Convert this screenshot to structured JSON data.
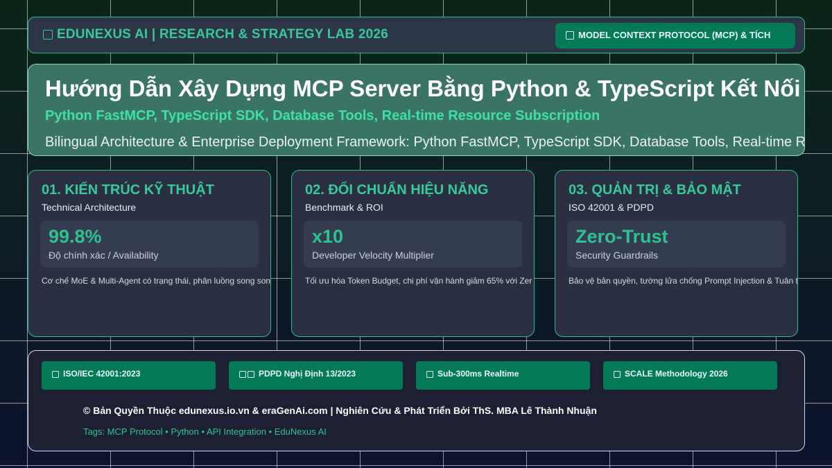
{
  "header": {
    "brand": "EDUNEXUS AI | RESEARCH & STRATEGY LAB 2026",
    "brand_icon": "box-icon",
    "badge": "MODEL CONTEXT PROTOCOL (MCP) & TÍCH",
    "badge_icon": "box-icon"
  },
  "hero": {
    "title": "Hướng Dẫn Xây Dựng MCP Server Bằng Python & TypeScript Kết Nối",
    "subtitle": "Python FastMCP, TypeScript SDK, Database Tools, Real-time Resource Subscription",
    "description": "Bilingual Architecture & Enterprise Deployment Framework: Python FastMCP, TypeScript SDK, Database Tools, Real-time Reso"
  },
  "cards": [
    {
      "title": "01. KIẾN TRÚC KỸ THUẬT",
      "subtitle": "Technical Architecture",
      "metric_value": "99.8%",
      "metric_label": "Độ chính xác / Availability",
      "text": "Cơ chế MoE & Multi-Agent có trạng thái, phân luồng song son"
    },
    {
      "title": "02. ĐỐI CHUẨN HIỆU NĂNG",
      "subtitle": "Benchmark & ROI",
      "metric_value": "x10",
      "metric_label": "Developer Velocity Multiplier",
      "text": "Tối ưu hóa Token Budget, chi phí vận hành giảm 65% với Zer"
    },
    {
      "title": "03. QUẢN TRỊ & BẢO MẬT",
      "subtitle": "ISO 42001 & PDPD",
      "metric_value": "Zero-Trust",
      "metric_label": "Security Guardrails",
      "text": "Bảo vệ bản quyền, tường lửa chống Prompt Injection & Tuân thủ"
    }
  ],
  "footer": {
    "chips": [
      "ISO/IEC 42001:2023",
      "PDPD Nghị Định 13/2023",
      "Sub-300ms Realtime",
      "SCALE Methodology 2026"
    ],
    "copyright": "© Bản Quyền Thuộc edunexus.io.vn & eraGenAi.com | Nghiên Cứu & Phát Triển Bởi ThS. MBA Lê Thành Nhuận",
    "tags": "Tags: MCP Protocol • Python • API Integration • EduNexus AI"
  },
  "colors": {
    "accent": "#37c99a",
    "chip_bg": "#057a56",
    "hero_bg": "#3a7464",
    "card_bg": "#2a2f43"
  }
}
